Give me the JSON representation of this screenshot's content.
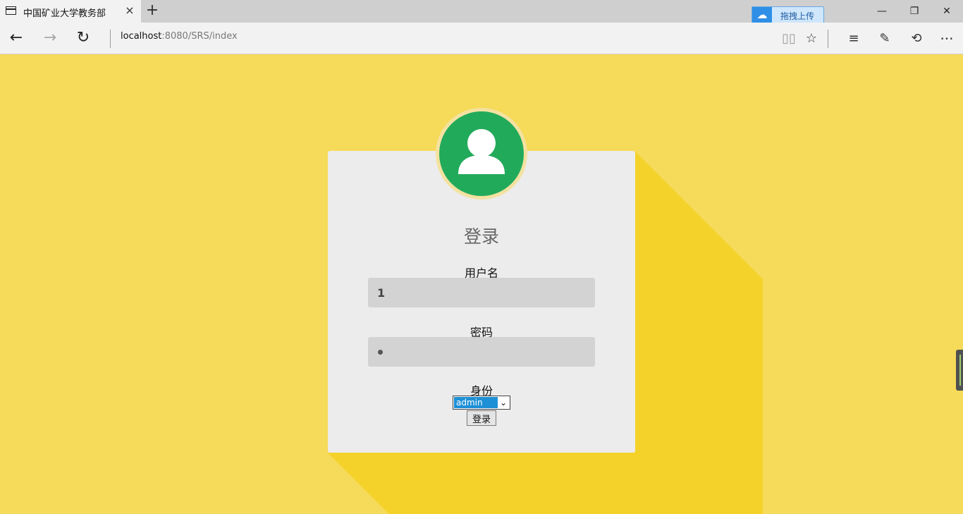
{
  "browser": {
    "tab": {
      "title": "中国矿业大学教务部",
      "close": "×"
    },
    "new_tab": "+",
    "window_controls": {
      "minimize": "—",
      "restore": "❐",
      "close": "✕"
    },
    "upload_extension": {
      "label": "拖拽上传"
    },
    "address": {
      "host": "localhost",
      "path": ":8080/SRS/index"
    },
    "nav": {
      "back": "←",
      "forward": "→",
      "refresh": "↻"
    },
    "toolbar": {
      "reading_view": "▯▯",
      "favorite": "☆",
      "hub": "≡",
      "web_note": "✎",
      "share": "⟲",
      "more": "···"
    }
  },
  "login": {
    "title": "登录",
    "username": {
      "label": "用户名",
      "value": "1"
    },
    "password": {
      "label": "密码"
    },
    "role": {
      "label": "身份",
      "selected": "admin"
    },
    "submit_label": "登录"
  },
  "colors": {
    "background": "#f6da59",
    "shadow": "#f4d229",
    "card": "#ececec",
    "avatar": "#22aa5b",
    "input": "#d3d3d3"
  }
}
